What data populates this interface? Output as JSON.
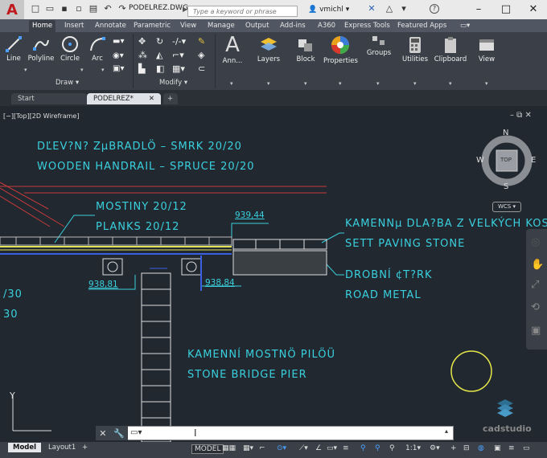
{
  "app": {
    "document_title": "PODELREZ.DWG"
  },
  "search": {
    "placeholder": "Type a keyword or phrase"
  },
  "user": {
    "name": "vmichl"
  },
  "ribbon_tabs": [
    "Home",
    "Insert",
    "Annotate",
    "Parametric",
    "View",
    "Manage",
    "Output",
    "Add-ins",
    "A360",
    "Express Tools",
    "Featured Apps"
  ],
  "draw_tools": [
    "Line",
    "Polyline",
    "Circle",
    "Arc"
  ],
  "panels": {
    "draw": "Draw",
    "modify": "Modify"
  },
  "big_tools": [
    "Ann...",
    "Layers",
    "Block",
    "Properties",
    "Groups",
    "Utilities",
    "Clipboard",
    "View"
  ],
  "file_tabs": {
    "start": "Start",
    "current": "PODELREZ*"
  },
  "viewport_label": "[−][Top][2D Wireframe]",
  "viewcube": {
    "n": "N",
    "s": "S",
    "e": "E",
    "w": "W",
    "face": "TOP",
    "ucs": "WCS"
  },
  "drawing_text": {
    "t1": "DŘEVĚNÉ ZÁBRADLÍ – SMRK 20/20",
    "t1_shown": "DĽEV?N? ZµBRADLÖ – SMRK 20/20",
    "t2": "WOODEN HANDRAIL – SPRUCE 20/20",
    "t3": "MOSTINY 20/12",
    "t4": "PLANKS 20/12",
    "t5": "KAMENNµ DLA?BA Z VELKÝCH KOST",
    "t6": "SETT PAVING STONE",
    "t7": "DROBNÍ ¢T?RK",
    "t8": "ROAD METAL",
    "t9": "KAMENNÍ MOSTNÖ PILÖÜ",
    "t10": "STONE BRIDGE PIER",
    "t11": "/30",
    "t12": "30",
    "d1": "939,44",
    "d2": "938,81",
    "d3": "938,84"
  },
  "command": {
    "placeholder": ""
  },
  "layout_tabs": [
    "Model",
    "Layout1"
  ],
  "status": {
    "model": "MODEL",
    "scale": "1:1"
  },
  "watermark": "cadstudio"
}
